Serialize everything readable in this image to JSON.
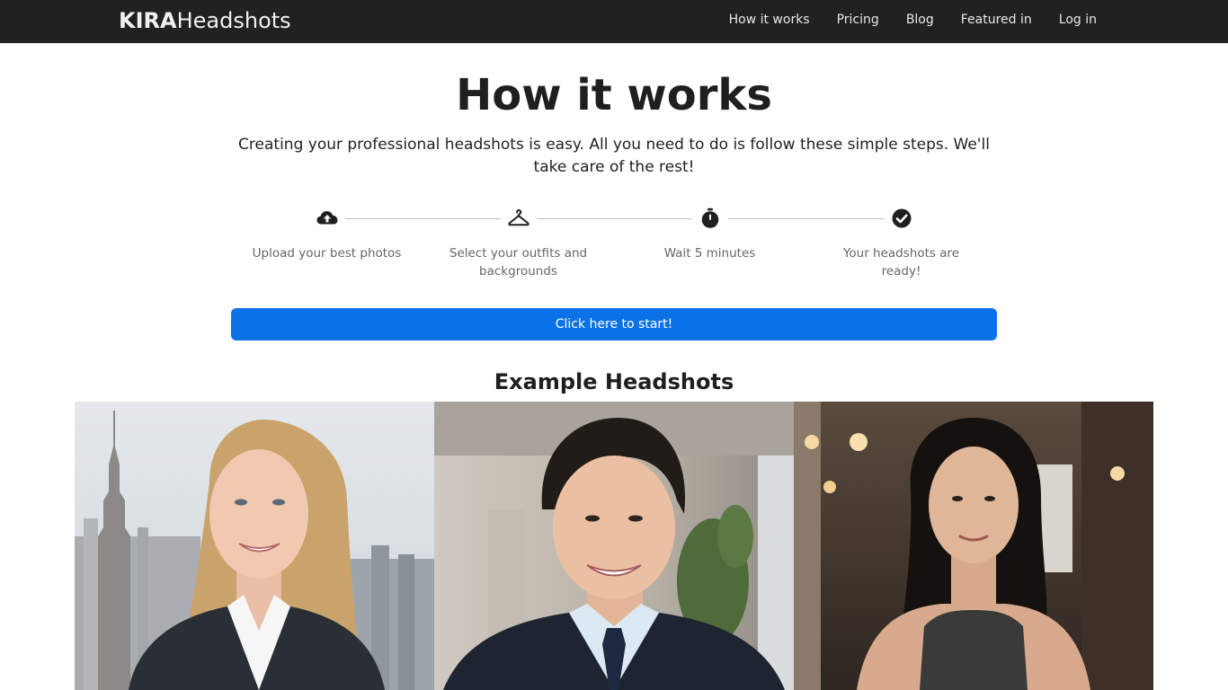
{
  "nav": {
    "brand_bold": "KIRA",
    "brand_rest": "Headshots",
    "links": [
      "How it works",
      "Pricing",
      "Blog",
      "Featured in",
      "Log in"
    ]
  },
  "hero": {
    "title": "How it works",
    "subtitle": "Creating your professional headshots is easy. All you need to do is follow these simple steps. We'll take care of the rest!"
  },
  "steps": [
    {
      "icon": "cloud-upload-icon",
      "label": "Upload your best photos"
    },
    {
      "icon": "hanger-icon",
      "label": "Select your outfits and backgrounds"
    },
    {
      "icon": "stopwatch-icon",
      "label": "Wait 5 minutes"
    },
    {
      "icon": "check-circle-icon",
      "label": "Your headshots are ready!"
    }
  ],
  "cta": {
    "label": "Click here to start!"
  },
  "examples": {
    "title": "Example Headshots"
  },
  "colors": {
    "navbar": "#212121",
    "accent": "#0a72e6"
  }
}
